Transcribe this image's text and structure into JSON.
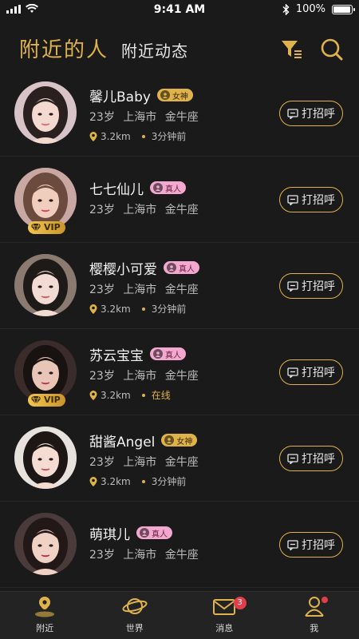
{
  "status_bar": {
    "time": "9:41 AM",
    "battery": "100%",
    "battery_level": 1.0
  },
  "header": {
    "tabs": [
      {
        "label": "附近的人",
        "active": true
      },
      {
        "label": "附近动态",
        "active": false
      }
    ],
    "filter_icon": "filter-icon",
    "search_icon": "search-icon"
  },
  "users": [
    {
      "name": "馨儿Baby",
      "badge": "女神",
      "badge_type": "goddess",
      "age": "23岁",
      "city": "上海市",
      "zodiac": "金牛座",
      "distance": "3.2km",
      "status": "3分钟前",
      "vip": false,
      "greet_label": "打招呼"
    },
    {
      "name": "七七仙儿",
      "badge": "真人",
      "badge_type": "real",
      "age": "23岁",
      "city": "上海市",
      "zodiac": "金牛座",
      "distance": "",
      "status": "",
      "vip": true,
      "vip_label": "VIP",
      "greet_label": "打招呼"
    },
    {
      "name": "樱樱小可爱",
      "badge": "真人",
      "badge_type": "real",
      "age": "23岁",
      "city": "上海市",
      "zodiac": "金牛座",
      "distance": "3.2km",
      "status": "3分钟前",
      "vip": false,
      "greet_label": "打招呼"
    },
    {
      "name": "苏云宝宝",
      "badge": "真人",
      "badge_type": "real",
      "age": "23岁",
      "city": "上海市",
      "zodiac": "金牛座",
      "distance": "3.2km",
      "status": "在线",
      "vip": true,
      "vip_label": "VIP",
      "greet_label": "打招呼"
    },
    {
      "name": "甜酱Angel",
      "badge": "女神",
      "badge_type": "goddess",
      "age": "23岁",
      "city": "上海市",
      "zodiac": "金牛座",
      "distance": "3.2km",
      "status": "3分钟前",
      "vip": false,
      "greet_label": "打招呼"
    },
    {
      "name": "萌琪儿",
      "badge": "真人",
      "badge_type": "real",
      "age": "23岁",
      "city": "上海市",
      "zodiac": "金牛座",
      "distance": "",
      "status": "",
      "vip": false,
      "greet_label": "打招呼"
    }
  ],
  "tabbar": {
    "items": [
      {
        "label": "附近",
        "icon": "nearby-icon",
        "active": true
      },
      {
        "label": "世界",
        "icon": "planet-icon",
        "active": false
      },
      {
        "label": "消息",
        "icon": "message-icon",
        "active": false,
        "badge": "3"
      },
      {
        "label": "我",
        "icon": "profile-icon",
        "active": false,
        "dot": true
      }
    ]
  },
  "colors": {
    "accent": "#e0b24a",
    "background": "#1a1a1a",
    "real_badge": "#f3a9cf",
    "notification": "#e23d4b"
  }
}
